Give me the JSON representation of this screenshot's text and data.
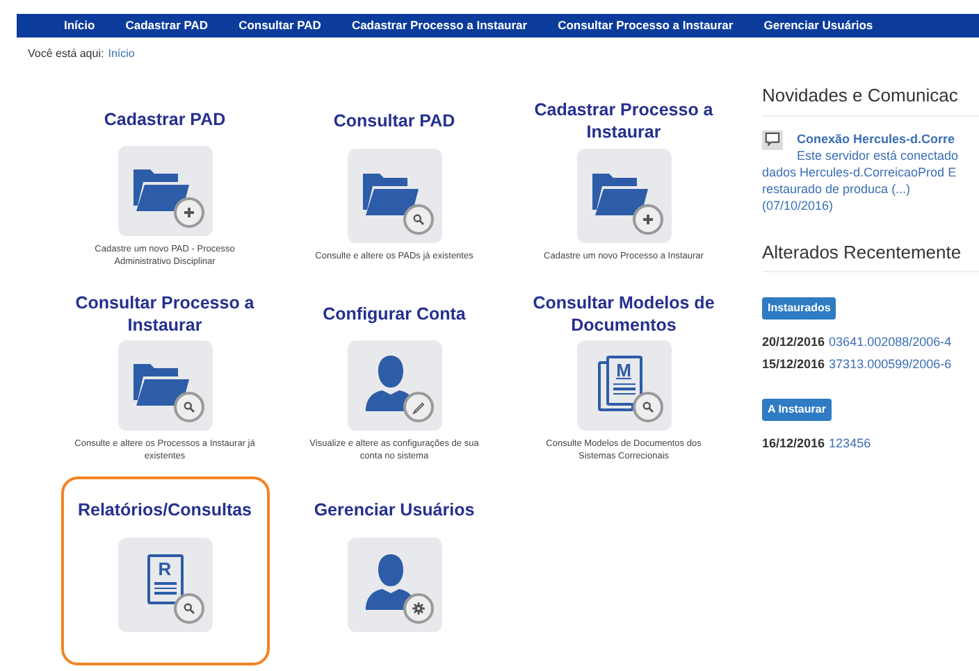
{
  "nav": [
    {
      "label": "Início"
    },
    {
      "label": "Cadastrar PAD"
    },
    {
      "label": "Consultar PAD"
    },
    {
      "label": "Cadastrar Processo a Instaurar"
    },
    {
      "label": "Consultar Processo a Instaurar"
    },
    {
      "label": "Gerenciar Usuários"
    }
  ],
  "breadcrumb": {
    "prefix": "Você está aqui:",
    "link": "Início"
  },
  "tiles": [
    {
      "title": "Cadastrar PAD",
      "kind": "addfolder",
      "description": "Cadastre um novo PAD - Processo Administrativo Disciplinar",
      "selected": false
    },
    {
      "title": "Consultar PAD",
      "kind": "findfolder",
      "description": "Consulte e altere os PADs já existentes",
      "selected": false
    },
    {
      "title": "Cadastrar Processo a Instaurar",
      "kind": "addfolder",
      "description": "Cadastre um novo Processo a Instaurar",
      "selected": false
    },
    {
      "title": "Consultar Processo a Instaurar",
      "kind": "findfolder",
      "description": "Consulte e altere os Processos a Instaurar já existentes",
      "selected": false
    },
    {
      "title": "Configurar Conta",
      "kind": "edituser",
      "description": "Visualize e altere as configurações de sua conta no sistema",
      "selected": false
    },
    {
      "title": "Consultar Modelos de Documentos",
      "kind": "finddocument",
      "letter": "M",
      "description": "Consulte Modelos de Documentos dos Sistemas Correcionais",
      "selected": false
    },
    {
      "title": "Relatórios/Consultas",
      "kind": "findreport",
      "letter": "R",
      "selected": true
    },
    {
      "title": "Gerenciar Usuários",
      "kind": "manageuser",
      "selected": false
    }
  ],
  "news": {
    "heading": "Novidades e Comunicac",
    "items": [
      {
        "title": "Conexão Hercules-d.Corre",
        "lines": [
          "Este servidor está conectado",
          "dados Hercules-d.CorreicaoProd E",
          "restaurado de produca (...)",
          "(07/10/2016)"
        ]
      }
    ]
  },
  "recent": {
    "heading": "Alterados Recentemente",
    "groups": [
      {
        "label": "Instaurados",
        "entries": [
          {
            "date": "20/12/2016",
            "link": "03641.002088/2006-4"
          },
          {
            "date": "15/12/2016",
            "link": "37313.000599/2006-6"
          }
        ]
      },
      {
        "label": "A Instaurar",
        "entries": [
          {
            "date": "16/12/2016",
            "link": "123456"
          }
        ]
      }
    ]
  }
}
